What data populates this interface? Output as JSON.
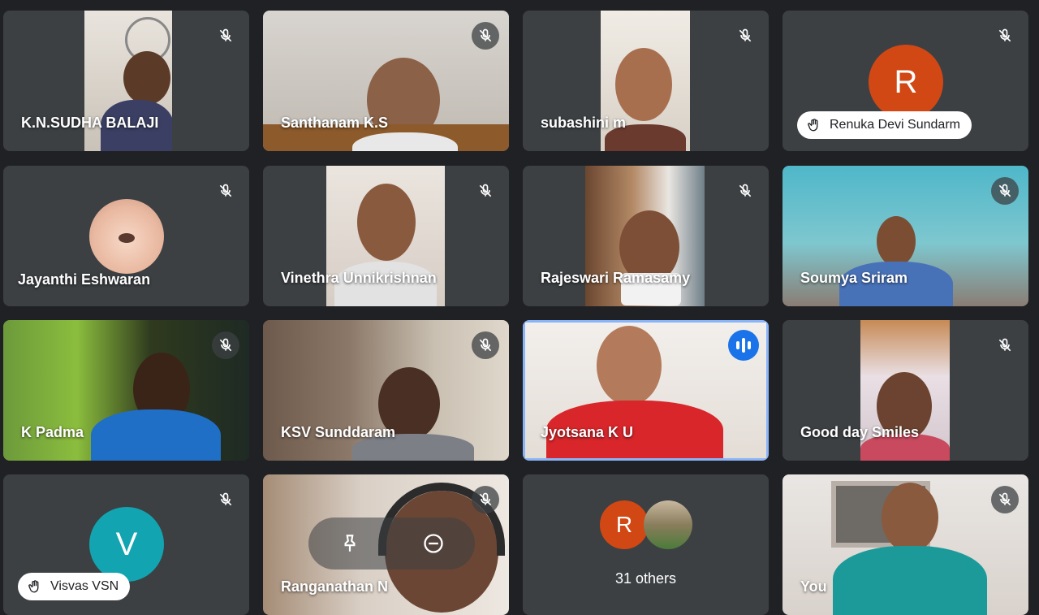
{
  "participants": [
    {
      "name": "K.N.SUDHA BALAJI"
    },
    {
      "name": "Santhanam K.S"
    },
    {
      "name": "subashini m"
    },
    {
      "name": "Renuka Devi Sundarm",
      "avatar_letter": "R"
    },
    {
      "name": "Jayanthi Eshwaran"
    },
    {
      "name": "Vinethra Unnikrishnan"
    },
    {
      "name": "Rajeswari Ramasamy"
    },
    {
      "name": "Soumya Sriram"
    },
    {
      "name": "K Padma"
    },
    {
      "name": "KSV Sunddaram"
    },
    {
      "name": "Jyotsana K U"
    },
    {
      "name": "Good day Smiles"
    },
    {
      "name": "Visvas VSN",
      "avatar_letter": "V"
    },
    {
      "name": "Ranganathan N"
    },
    {
      "name": "You"
    }
  ],
  "others": {
    "label": "31 others",
    "avatar_letter": "R"
  },
  "colors": {
    "background": "#202124",
    "tile": "#3c4043",
    "speaking_border": "#8ab4f8",
    "avatar_r": "#d14814",
    "avatar_v": "#12a4b0"
  },
  "icons": {
    "muted": "mic-off-icon",
    "raised_hand": "hand-icon",
    "speaking": "audio-level-icon",
    "pin": "pin-icon",
    "remove": "remove-icon"
  }
}
